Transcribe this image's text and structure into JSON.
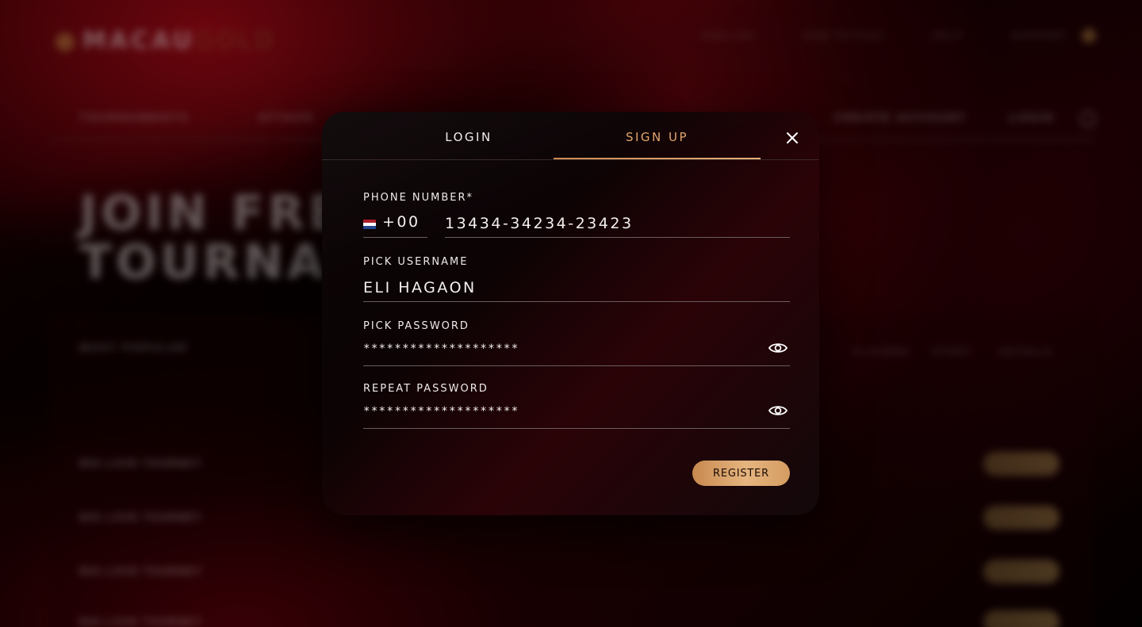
{
  "background": {
    "logo_main": "MACAU",
    "logo_accent": "GOLD",
    "top_nav": [
      "ENGLISH",
      "HOW TO PLAY",
      "HELP",
      "SUPPORT"
    ],
    "sub_nav": [
      "TOURNAMENTS",
      "ATTACK"
    ],
    "sub_nav_right": [
      "CREATE ACCOUNT",
      "LOGIN"
    ],
    "hero_line1": "JOIN FRE",
    "hero_line2": "TOURNAI",
    "table_title": "MOST POPULAR",
    "table_columns": [
      "PLAYERS",
      "START",
      "DETAILS"
    ],
    "rows": [
      {
        "name": "BIG LOVE TOURNEY"
      },
      {
        "name": "BIG LOVE TOURNEY"
      },
      {
        "name": "BIG LOVE TOURNEY"
      },
      {
        "name": "BIG LOVE TOURNEY"
      }
    ]
  },
  "modal": {
    "tabs": {
      "login": "LOGIN",
      "signup": "SIGN UP",
      "active": "signup"
    },
    "phone": {
      "label": "PHONE NUMBER*",
      "country_code": "+00",
      "value": "13434-34234-23423"
    },
    "username": {
      "label": "PICK USERNAME",
      "value": "ELI HAGAON"
    },
    "password": {
      "label": "PICK PASSWORD",
      "value": "********************"
    },
    "repeat_password": {
      "label": "REPEAT PASSWORD",
      "value": "********************"
    },
    "register_label": "REGISTER"
  },
  "colors": {
    "accent": "#e3a66b",
    "button_gradient_start": "#c7894f",
    "button_gradient_end": "#e6b57f",
    "text": "#f4f0f0",
    "divider": "#6a5c5e"
  },
  "icons": {
    "close": "close-icon",
    "show_password": "eye-icon",
    "flag": "netherlands-flag-icon"
  }
}
